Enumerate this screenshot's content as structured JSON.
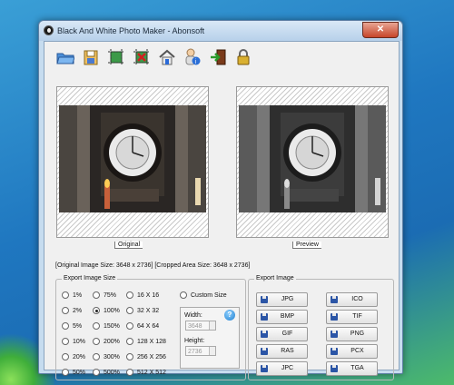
{
  "window": {
    "title": "Black And White Photo Maker - Abonsoft",
    "close_label": "✕"
  },
  "toolbar": [
    "open-folder-icon",
    "save-icon",
    "crop-icon",
    "remove-crop-icon",
    "home-icon",
    "about-icon",
    "exit-icon",
    "lock-icon"
  ],
  "panels": {
    "original_caption": "Original",
    "preview_caption": "Preview"
  },
  "info": "[Original Image Size:  3648 x 2736]  [Cropped Area Size:  3648 x 2736]",
  "export_size": {
    "title": "Export Image Size",
    "options": [
      "1%",
      "2%",
      "5%",
      "10%",
      "20%",
      "50%",
      "75%",
      "100%",
      "150%",
      "200%",
      "300%",
      "500%",
      "16 X 16",
      "32 X 32",
      "64 X 64",
      "128 X 128",
      "256 X 256",
      "512 X 512",
      "Custom Size"
    ],
    "selected": "100%",
    "width_label": "Width:",
    "width_value": "3648",
    "height_label": "Height:",
    "height_value": "2736"
  },
  "export_image": {
    "title": "Export Image",
    "buttons": [
      "JPG",
      "ICO",
      "BMP",
      "TIF",
      "GIF",
      "PNG",
      "RAS",
      "PCX",
      "JPC",
      "TGA"
    ]
  }
}
